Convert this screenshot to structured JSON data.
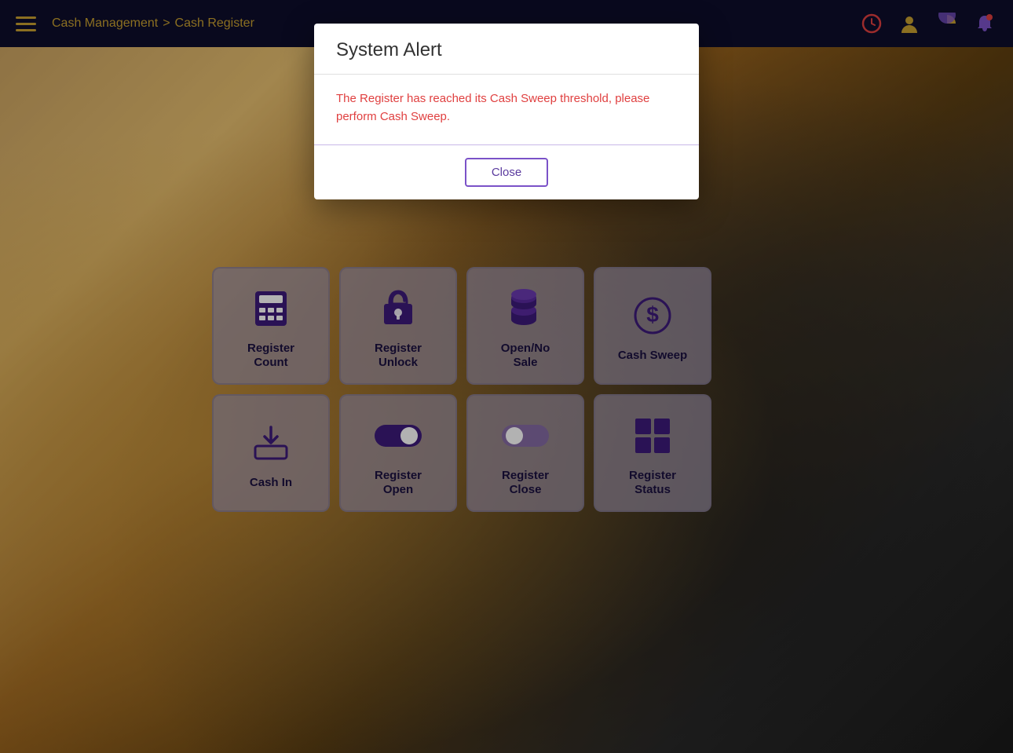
{
  "navbar": {
    "breadcrumb_part1": "Cash Management",
    "breadcrumb_sep": ">",
    "breadcrumb_part2": "Cash Register"
  },
  "buttons": [
    {
      "id": "register-count",
      "label": "Register\nCount",
      "label_line1": "Register",
      "label_line2": "Count",
      "icon": "calculator"
    },
    {
      "id": "register-unlock",
      "label": "Register\nUnlock",
      "label_line1": "Register",
      "label_line2": "Unlock",
      "icon": "lock"
    },
    {
      "id": "open-no-sale",
      "label": "Open/No\nSale",
      "label_line1": "Open/No",
      "label_line2": "Sale",
      "icon": "coins"
    },
    {
      "id": "cash-sweep",
      "label": "Cash Sweep",
      "label_line1": "Cash Sweep",
      "label_line2": "",
      "icon": "dollar"
    },
    {
      "id": "cash-in",
      "label": "Cash In",
      "label_line1": "Cash In",
      "label_line2": "",
      "icon": "inbox-down"
    },
    {
      "id": "register-open",
      "label": "Register\nOpen",
      "label_line1": "Register",
      "label_line2": "Open",
      "icon": "toggle-on"
    },
    {
      "id": "register-close",
      "label": "Register\nClose",
      "label_line1": "Register",
      "label_line2": "Close",
      "icon": "toggle-off"
    },
    {
      "id": "register-status",
      "label": "Register\nStatus",
      "label_line1": "Register",
      "label_line2": "Status",
      "icon": "grid"
    }
  ],
  "modal": {
    "title": "System Alert",
    "message": "The Register has reached its Cash Sweep threshold, please perform Cash Sweep.",
    "close_button": "Close"
  }
}
